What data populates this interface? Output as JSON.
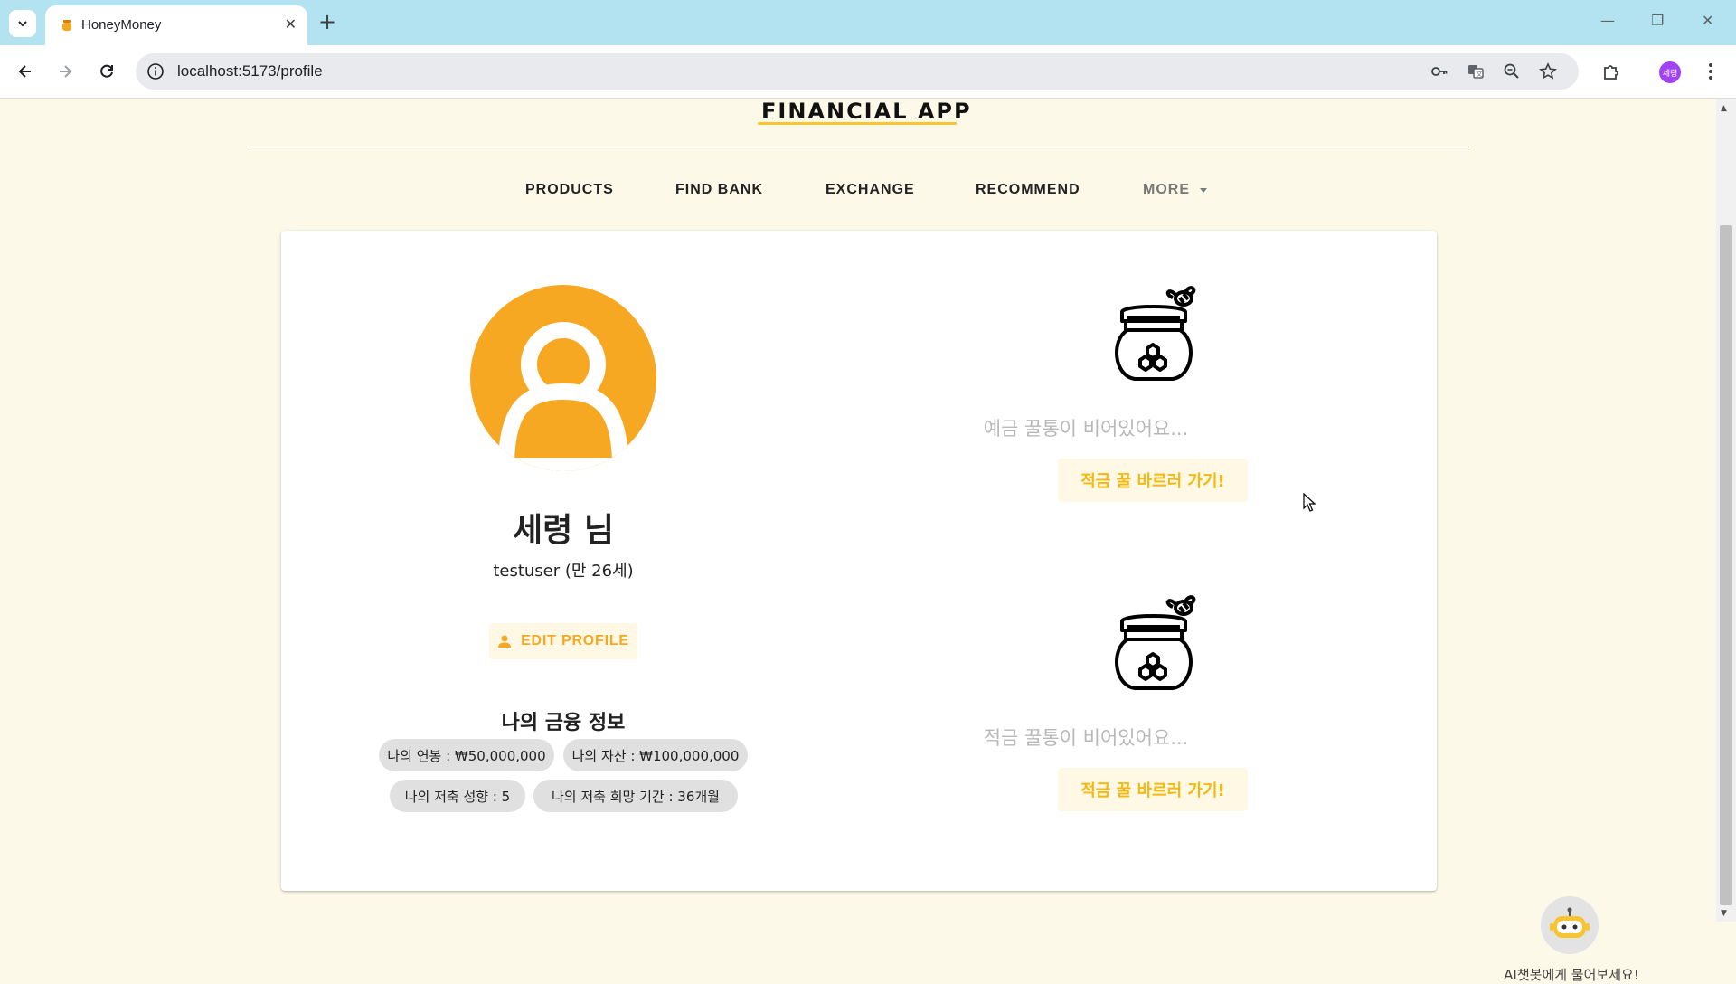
{
  "browser": {
    "tab_title": "HoneyMoney",
    "close_glyph": "✕",
    "new_tab_glyph": "+",
    "url": "localhost:5173/profile",
    "profile_initials": "세령",
    "window_controls": {
      "minimize": "—",
      "restore": "❐",
      "close": "✕"
    }
  },
  "header": {
    "logo": "FINANCIAL APP",
    "nav": [
      "PRODUCTS",
      "FIND BANK",
      "EXCHANGE",
      "RECOMMEND",
      "MORE"
    ]
  },
  "profile": {
    "name": "세령 님",
    "subtitle": "testuser (만 26세)",
    "edit_button": "EDIT PROFILE",
    "finance_title": "나의 금융 정보",
    "chips": [
      "나의 연봉 : ₩50,000,000",
      "나의 자산 : ₩100,000,000",
      "나의 저축 성향 : 5",
      "나의 저축 희망 기간 : 36개월"
    ]
  },
  "honey_jars": [
    {
      "empty_text": "예금 꿀통이 비어있어요...",
      "button": "적금 꿀 바르러 가기!"
    },
    {
      "empty_text": "적금 꿀통이 비어있어요...",
      "button": "적금 꿀 바르러 가기!"
    }
  ],
  "chatbot": {
    "label": "AI챗봇에게 물어보세요!"
  },
  "colors": {
    "accent": "#f7a823",
    "page_bg": "#fdf9e8",
    "chrome": "#b3e3f0",
    "button_text": "#f5b80f"
  }
}
